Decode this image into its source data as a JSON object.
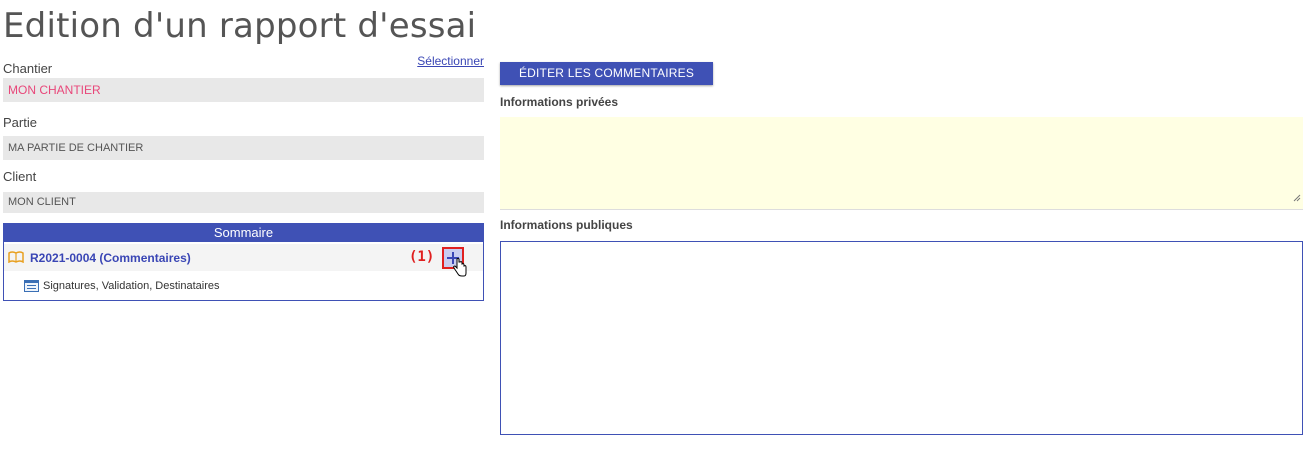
{
  "page": {
    "title": "Edition d'un rapport d'essai"
  },
  "fields": {
    "chantier": {
      "label": "Chantier",
      "value": "MON CHANTIER",
      "select_link": "Sélectionner"
    },
    "partie": {
      "label": "Partie",
      "value": "MA PARTIE DE CHANTIER"
    },
    "client": {
      "label": "Client",
      "value": "MON CLIENT"
    }
  },
  "summary": {
    "header": "Sommaire",
    "items": [
      {
        "label": "R2021-0004 (Commentaires)",
        "icon": "book-icon",
        "callout": "(1)",
        "action_icon": "plus-icon"
      },
      {
        "label": "Signatures, Validation, Destinataires",
        "icon": "form-icon"
      }
    ]
  },
  "comments": {
    "edit_button": "ÉDITER LES COMMENTAIRES",
    "private_label": "Informations privées",
    "public_label": "Informations publiques",
    "private_value": "",
    "public_value": ""
  },
  "colors": {
    "accent": "#3f51b5",
    "highlight": "#e8477a",
    "private_bg": "#ffffe3",
    "callout": "#e02020"
  }
}
